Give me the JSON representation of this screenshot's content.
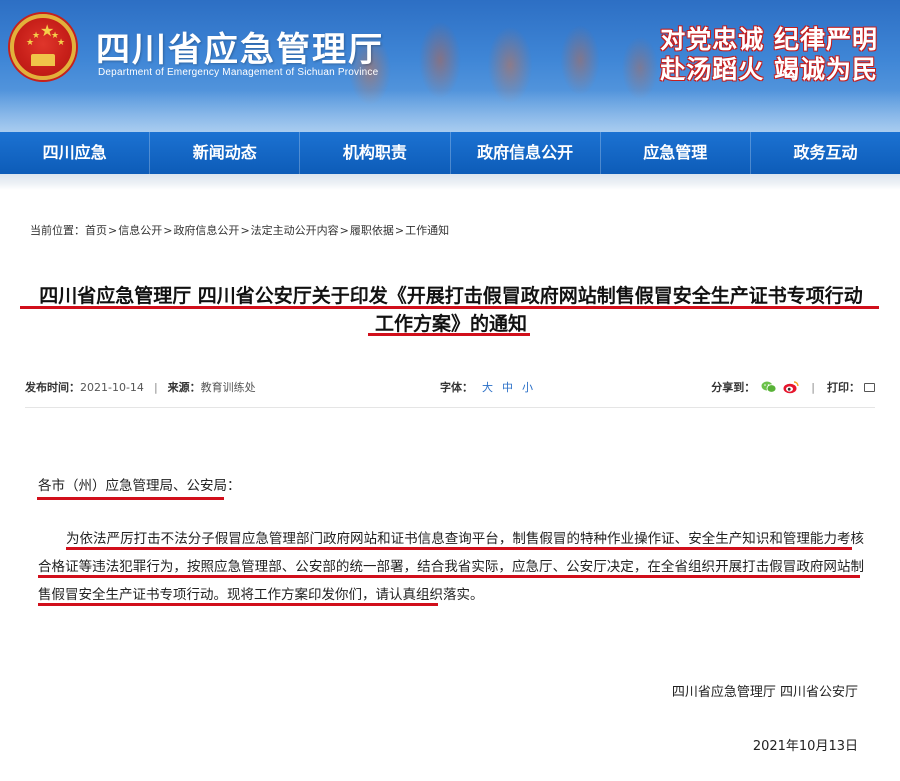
{
  "header": {
    "site_title": "四川省应急管理厅",
    "site_subtitle": "Department of Emergency Management of Sichuan Province",
    "slogan_line1": "对党忠诚  纪律严明",
    "slogan_line2": "赴汤蹈火  竭诚为民"
  },
  "nav": {
    "items": [
      {
        "label": "四川应急"
      },
      {
        "label": "新闻动态"
      },
      {
        "label": "机构职责"
      },
      {
        "label": "政府信息公开"
      },
      {
        "label": "应急管理"
      },
      {
        "label": "政务互动"
      }
    ]
  },
  "breadcrumb": {
    "prefix": "当前位置：",
    "items": [
      "首页",
      "信息公开",
      "政府信息公开",
      "法定主动公开内容",
      "履职依据",
      "工作通知"
    ],
    "separator": ">"
  },
  "article": {
    "title_line1": "四川省应急管理厅 四川省公安厅关于印发《开展打击假冒政府网站制售假冒安全生产证书专项行动",
    "title_line2": "工作方案》的通知",
    "meta": {
      "publish_label": "发布时间：",
      "publish_date": "2021-10-14",
      "source_label": "来源：",
      "source": "教育训练处",
      "font_label": "字体：",
      "font_large": "大",
      "font_medium": "中",
      "font_small": "小",
      "share_label": "分享到：",
      "print_label": "打印："
    },
    "salutation": "各市（州）应急管理局、公安局：",
    "paragraph": "为依法严厉打击不法分子假冒应急管理部门政府网站和证书信息查询平台，制售假冒的特种作业操作证、安全生产知识和管理能力考核合格证等违法犯罪行为，按照应急管理部、公安部的统一部署，结合我省实际，应急厅、公安厅决定，在全省组织开展打击假冒政府网站制售假冒安全生产证书专项行动。现将工作方案印发你们，请认真组织落实。",
    "signature": "四川省应急管理厅  四川省公安厅",
    "date": "2021年10月13日"
  },
  "colors": {
    "nav_blue": "#0d5cb8",
    "highlight_red": "#d10f1b",
    "link_blue": "#2a6fc7"
  }
}
